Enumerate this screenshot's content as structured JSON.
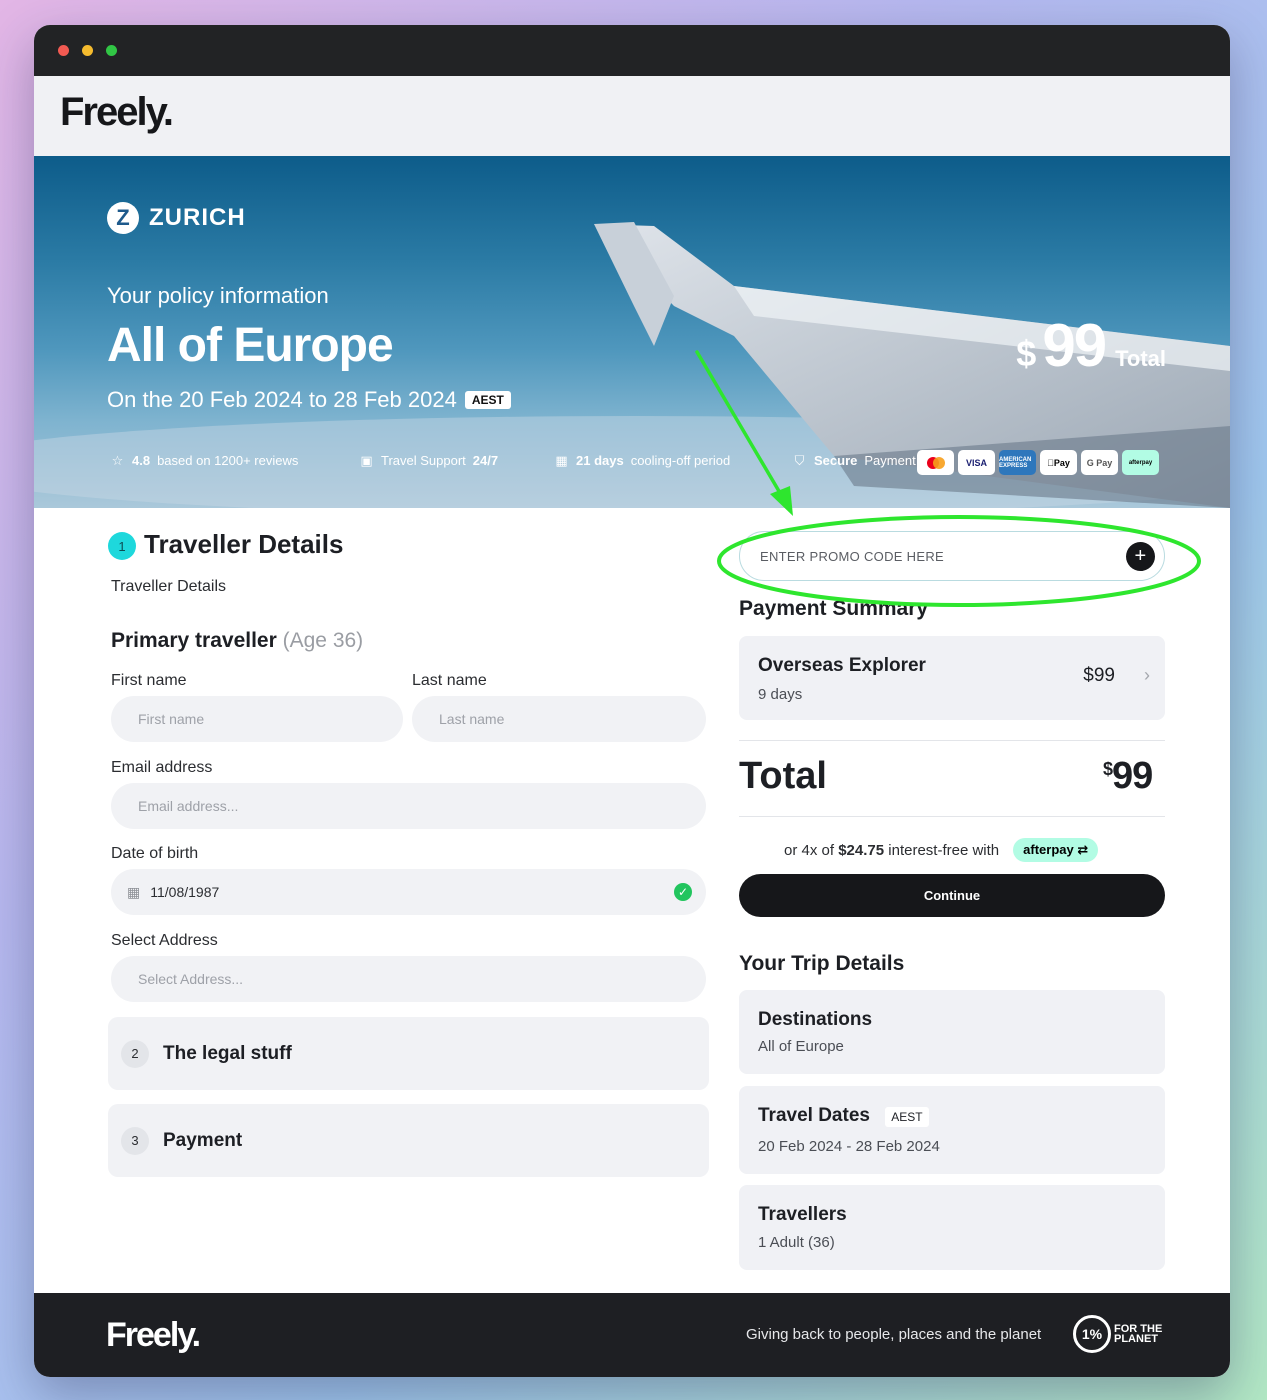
{
  "app": {
    "brand": "Freely."
  },
  "hero": {
    "insurer": "ZURICH",
    "subtitle": "Your policy information",
    "title": "All of Europe",
    "dates": "On the 20 Feb 2024 to 28 Feb 2024",
    "timezone": "AEST",
    "price_currency": "$",
    "price_amount": "99",
    "price_label": "Total",
    "trust": {
      "rating_value": "4.8",
      "rating_text": "based on 1200+ reviews",
      "support_text": "Travel Support",
      "support_value": "24/7",
      "cooling_value": "21 days",
      "cooling_text": "cooling-off period",
      "secure_bold": "Secure",
      "secure_text": "Payment"
    },
    "payment_cards": [
      "mastercard",
      "VISA",
      "AMERICAN EXPRESS",
      "Pay",
      "G Pay",
      "afterpay"
    ]
  },
  "traveller": {
    "step": "1",
    "title": "Traveller Details",
    "subtitle": "Traveller Details",
    "primary_label": "Primary traveller",
    "age": "(Age 36)",
    "first_name_label": "First name",
    "first_name_placeholder": "First name",
    "last_name_label": "Last name",
    "last_name_placeholder": "Last name",
    "email_label": "Email address",
    "email_placeholder": "Email address...",
    "dob_label": "Date of birth",
    "dob_value": "11/08/1987",
    "address_label": "Select Address",
    "address_placeholder": "Select Address..."
  },
  "steps": [
    {
      "num": "2",
      "title": "The legal stuff"
    },
    {
      "num": "3",
      "title": "Payment"
    }
  ],
  "summary": {
    "promo_placeholder": "ENTER PROMO CODE HERE",
    "heading": "Payment Summary",
    "plan_name": "Overseas Explorer",
    "plan_days": "9 days",
    "plan_price": "$99",
    "total_label": "Total",
    "total_currency": "$",
    "total_amount": "99",
    "afterpay_prefix": "or 4x of",
    "afterpay_amount": "$24.75",
    "afterpay_suffix": "interest-free with",
    "afterpay_badge": "afterpay",
    "continue_label": "Continue"
  },
  "trip": {
    "heading": "Your Trip Details",
    "destinations_label": "Destinations",
    "destinations_value": "All of Europe",
    "dates_label": "Travel Dates",
    "dates_tz": "AEST",
    "dates_value": "20 Feb 2024 - 28 Feb 2024",
    "travellers_label": "Travellers",
    "travellers_value": "1 Adult (36)"
  },
  "footer": {
    "brand": "Freely.",
    "tagline": "Giving back to people, places and the planet",
    "ftp_number": "1%",
    "ftp_line1": "FOR THE",
    "ftp_line2": "PLANET"
  },
  "colors": {
    "accent_teal": "#1ed8dc",
    "annotation_green": "#2ee62e",
    "dark": "#16171a",
    "afterpay_mint": "#b2fce4"
  }
}
